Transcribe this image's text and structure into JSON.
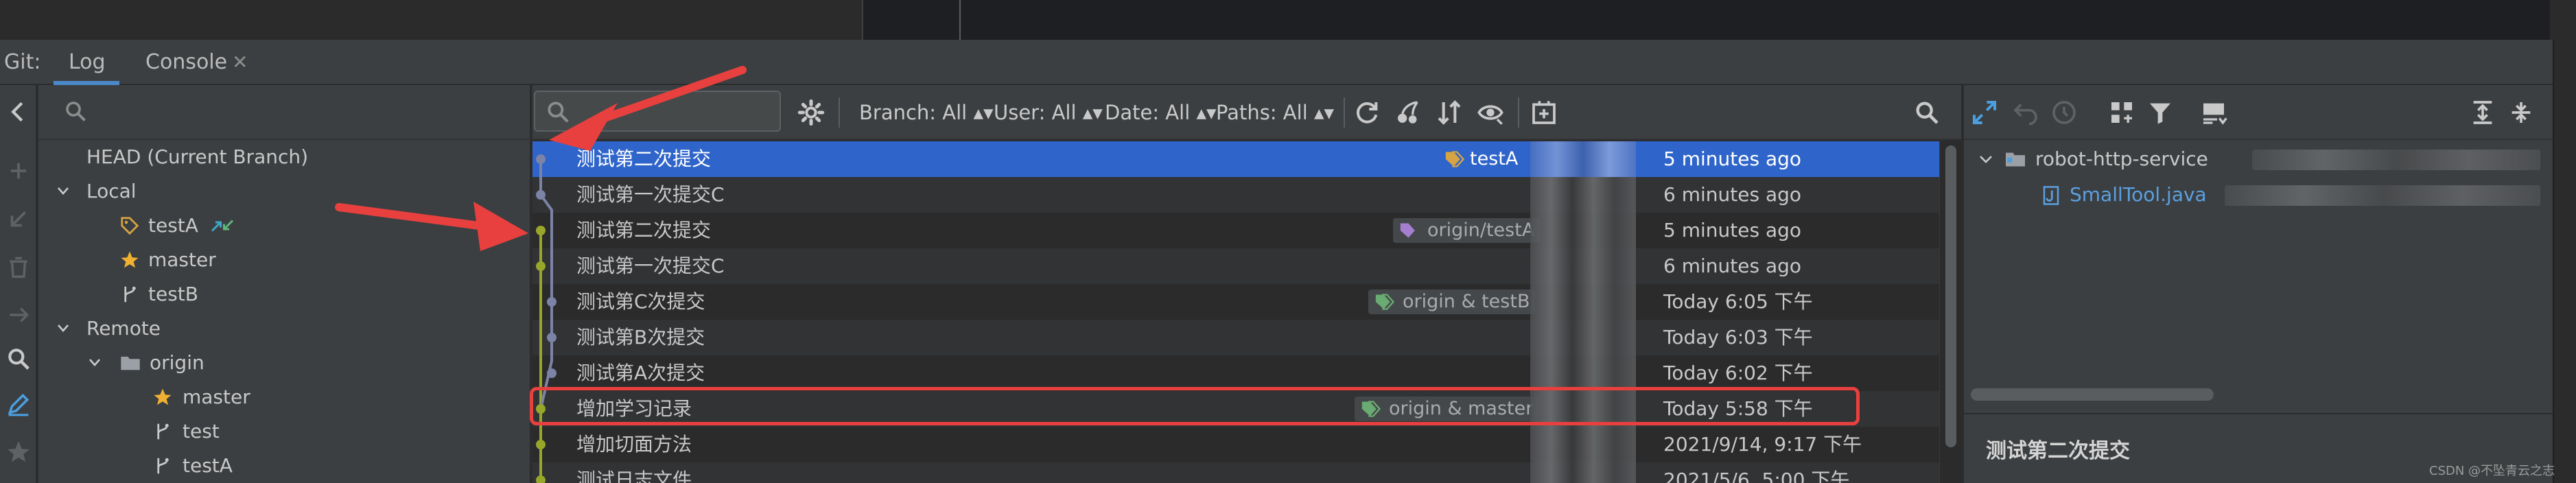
{
  "tabs": {
    "tool_label": "Git:",
    "log": "Log",
    "console": "Console"
  },
  "branches": {
    "search_placeholder": "",
    "head": "HEAD (Current Branch)",
    "local": "Local",
    "local_items": [
      "testA",
      "master",
      "testB"
    ],
    "remote": "Remote",
    "origin": "origin",
    "remote_items": [
      "master",
      "test",
      "testA"
    ]
  },
  "toolbar": {
    "branch": "Branch: All",
    "user": "User: All",
    "date": "Date: All",
    "paths": "Paths: All"
  },
  "log": [
    {
      "message": "测试第二次提交",
      "ref": "testA",
      "date": "5 minutes ago"
    },
    {
      "message": "测试第一次提交C",
      "ref": "",
      "date": "6 minutes ago"
    },
    {
      "message": "测试第二次提交",
      "ref": "origin/testA",
      "date": "5 minutes ago"
    },
    {
      "message": "测试第一次提交C",
      "ref": "",
      "date": "6 minutes ago"
    },
    {
      "message": "测试第C次提交",
      "ref": "origin & testB",
      "date": "Today 6:05 下午"
    },
    {
      "message": "测试第B次提交",
      "ref": "",
      "date": "Today 6:03 下午"
    },
    {
      "message": "测试第A次提交",
      "ref": "",
      "date": "Today 6:02 下午"
    },
    {
      "message": "增加学习记录",
      "ref": "origin & master",
      "date": "Today 5:58 下午"
    },
    {
      "message": "增加切面方法",
      "ref": "",
      "date": "2021/9/14, 9:17 下午"
    },
    {
      "message": "测试日志文件",
      "ref": "",
      "date": "2021/5/6, 5:00 下午"
    }
  ],
  "details": {
    "module": "robot-http-service",
    "file": "SmallTool.java",
    "subject": "测试第二次提交"
  },
  "colors": {
    "selection": "#2f65ca",
    "accent": "#4a88c7",
    "file_link": "#5aa0e0",
    "graph_head": "#7b83a6",
    "graph_master": "#98a72a",
    "annotation": "#e8403e"
  },
  "watermark": "CSDN @不坠青云之志"
}
